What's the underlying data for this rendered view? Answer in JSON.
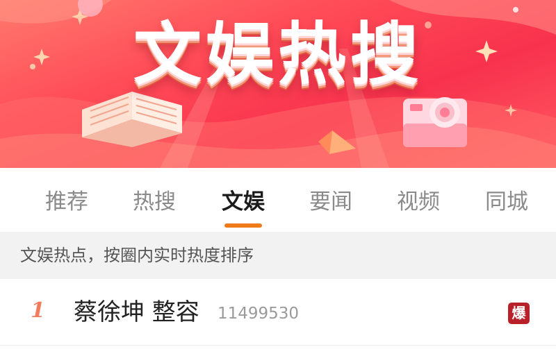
{
  "banner": {
    "title": "文娱热搜"
  },
  "tabs": [
    {
      "label": "推荐",
      "active": false
    },
    {
      "label": "热搜",
      "active": false
    },
    {
      "label": "文娱",
      "active": true
    },
    {
      "label": "要闻",
      "active": false
    },
    {
      "label": "视频",
      "active": false
    },
    {
      "label": "同城",
      "active": false
    }
  ],
  "hint": {
    "text": "文娱热点，按圈内实时热度排序"
  },
  "list": [
    {
      "rank": "1",
      "topic": "蔡徐坤 整容",
      "heat": "11499530",
      "badge": "爆"
    }
  ],
  "colors": {
    "banner_primary": "#f8324d",
    "tab_underline": "#f07b1b",
    "rank_color": "#f47a5c",
    "badge_bg": "#b8202a"
  },
  "icons": {
    "banner_left": "open-book-icon",
    "banner_right": "camera-icon",
    "banner_mid": "pyramid-gem-icon",
    "badge": "explode-badge-icon"
  }
}
